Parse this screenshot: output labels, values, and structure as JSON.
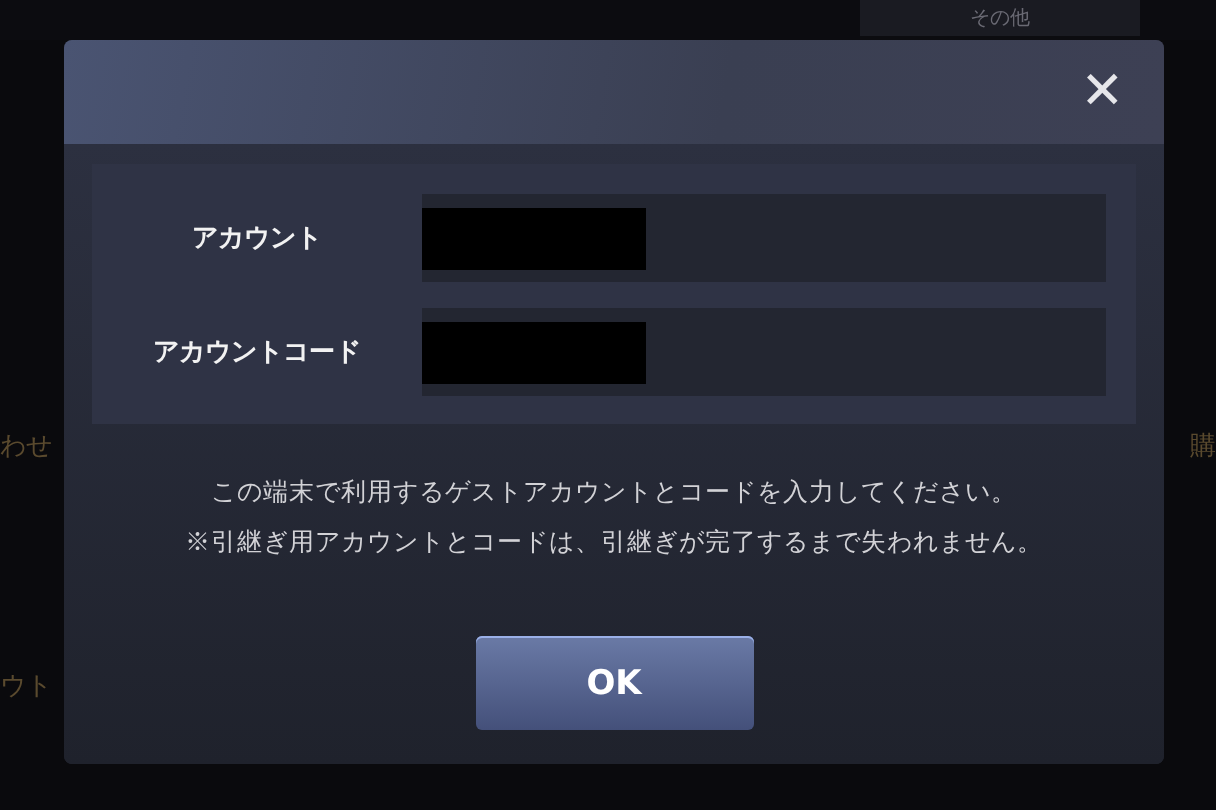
{
  "background": {
    "tab": {
      "label": "その他",
      "selected": true
    },
    "fragments": [
      "わせ",
      "ウト",
      "購"
    ]
  },
  "dialog": {
    "close": "✕",
    "fields": [
      {
        "label": "アカウント",
        "redacted": true
      },
      {
        "label": "アカウントコード",
        "redacted": true
      }
    ],
    "message": [
      "この端末で利用するゲストアカウントとコードを入力してください。",
      "※引継ぎ用アカウントとコードは、引継ぎが完了するまで失われません。"
    ],
    "buttons": [
      "OK"
    ]
  }
}
